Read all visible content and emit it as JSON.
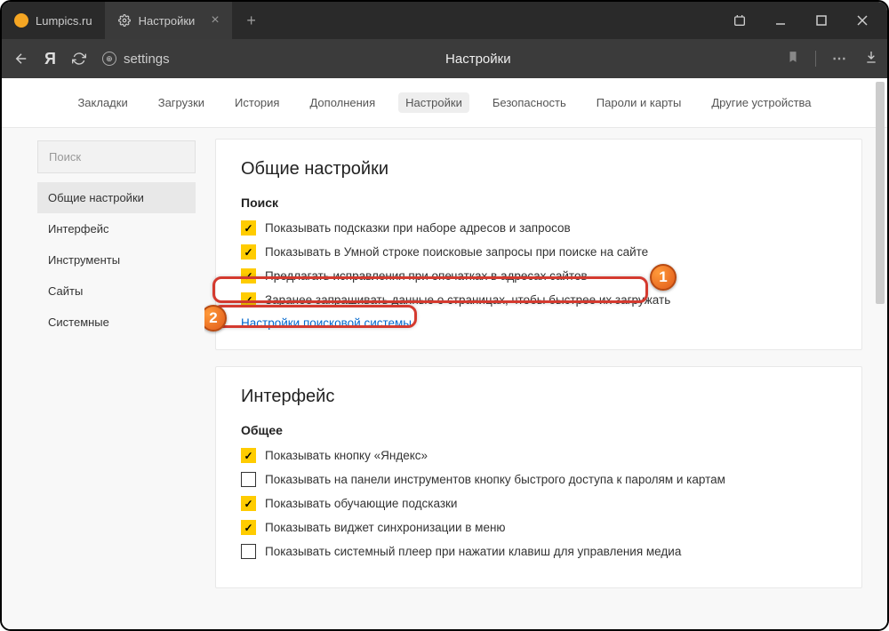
{
  "tabs": [
    {
      "label": "Lumpics.ru",
      "active": false
    },
    {
      "label": "Настройки",
      "active": true
    }
  ],
  "addressbar": {
    "url_text": "settings",
    "center_title": "Настройки"
  },
  "topnav": [
    "Закладки",
    "Загрузки",
    "История",
    "Дополнения",
    "Настройки",
    "Безопасность",
    "Пароли и карты",
    "Другие устройства"
  ],
  "topnav_active_index": 4,
  "sidebar": {
    "search_placeholder": "Поиск",
    "items": [
      "Общие настройки",
      "Интерфейс",
      "Инструменты",
      "Сайты",
      "Системные"
    ],
    "active_index": 0
  },
  "panels": {
    "general": {
      "title": "Общие настройки",
      "search_section": {
        "title": "Поиск",
        "options": [
          {
            "checked": true,
            "label": "Показывать подсказки при наборе адресов и запросов"
          },
          {
            "checked": true,
            "label": "Показывать в Умной строке поисковые запросы при поиске на сайте"
          },
          {
            "checked": true,
            "label": "Предлагать исправления при опечатках в адресах сайтов"
          },
          {
            "checked": true,
            "label": "Заранее запрашивать данные о страницах, чтобы быстрее их загружать"
          }
        ],
        "link": "Настройки поисковой системы"
      }
    },
    "interface": {
      "title": "Интерфейс",
      "general_section": {
        "title": "Общее",
        "options": [
          {
            "checked": true,
            "label": "Показывать кнопку «Яндекс»"
          },
          {
            "checked": false,
            "label": "Показывать на панели инструментов кнопку быстрого доступа к паролям и картам"
          },
          {
            "checked": true,
            "label": "Показывать обучающие подсказки"
          },
          {
            "checked": true,
            "label": "Показывать виджет синхронизации в меню"
          },
          {
            "checked": false,
            "label": "Показывать системный плеер при нажатии клавиш для управления медиа"
          }
        ]
      }
    }
  },
  "callouts": {
    "badge1": "1",
    "badge2": "2"
  }
}
